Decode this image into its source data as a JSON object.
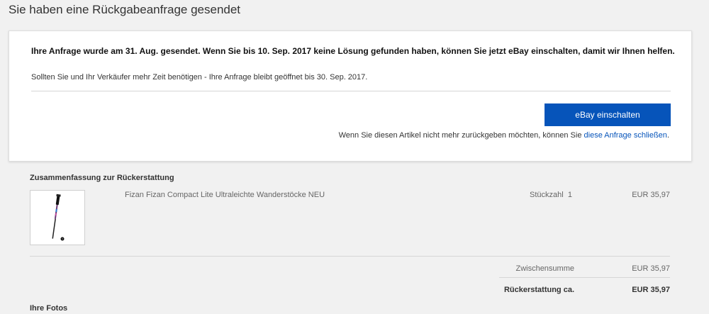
{
  "page": {
    "title": "Sie haben eine Rückgabeanfrage gesendet"
  },
  "notice": {
    "headline": "Ihre Anfrage wurde am 31. Aug. gesendet. Wenn Sie bis 10. Sep. 2017 keine Lösung gefunden haben, können Sie jetzt eBay einschalten, damit wir Ihnen helfen.",
    "subtext": "Sollten Sie und Ihr Verkäufer mehr Zeit benötigen - Ihre Anfrage bleibt geöffnet bis 30. Sep. 2017.",
    "button_label": "eBay einschalten",
    "close_text": "Wenn Sie diesen Artikel nicht mehr zurückgeben möchten, können Sie ",
    "close_link": "diese Anfrage schließen",
    "close_suffix": "."
  },
  "refund_summary": {
    "title": "Zusammenfassung zur Rückerstattung",
    "item": {
      "name": "Fizan Fizan Compact Lite Ultraleichte Wanderstöcke NEU",
      "quantity_label": "Stückzahl",
      "quantity": "1",
      "price": "EUR 35,97",
      "thumbnail_icon": "trekking-pole-icon"
    },
    "subtotal_label": "Zwischensumme",
    "subtotal_value": "EUR 35,97",
    "refund_label": "Rückerstattung ca.",
    "refund_value": "EUR 35,97"
  },
  "photos": {
    "title": "Ihre Fotos"
  },
  "colors": {
    "background": "#f1f1f1",
    "card": "#ffffff",
    "button": "#0654ba",
    "link": "#0654ba"
  }
}
